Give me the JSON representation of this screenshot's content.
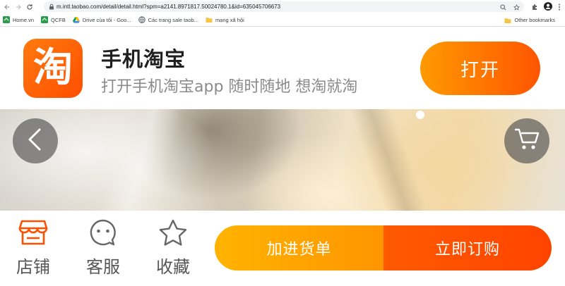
{
  "browser": {
    "url": "m.intl.taobao.com/detail/detail.html?spm=a2141.8971817.50024780.1&id=635045706673",
    "bookmarks": [
      {
        "label": "Home.vn",
        "icon": "home-vn-icon",
        "color": "#2a9d4a"
      },
      {
        "label": "QCFB",
        "icon": "qcfb-icon",
        "color": "#2a9d4a"
      },
      {
        "label": "Drive của tôi - Goo...",
        "icon": "google-drive-icon",
        "color": "#fbbc04"
      },
      {
        "label": "Các trang sale taob...",
        "icon": "globe-icon",
        "color": "#5f6368"
      },
      {
        "label": "mạng xã hội",
        "icon": "folder-icon",
        "color": "#f6c446"
      }
    ],
    "other_bookmarks": "Other bookmarks"
  },
  "banner": {
    "app_icon_char": "淘",
    "title": "手机淘宝",
    "subtitle": "打开手机淘宝app 随时随地 想淘就淘",
    "open_label": "打开"
  },
  "toolbar": {
    "store_label": "店铺",
    "service_label": "客服",
    "favorite_label": "收藏",
    "add_to_cart_label": "加进货单",
    "buy_now_label": "立即订购"
  },
  "colors": {
    "brand_orange": "#ff5500",
    "cart_orange": "#ffa200",
    "buy_red": "#ff4a00"
  }
}
